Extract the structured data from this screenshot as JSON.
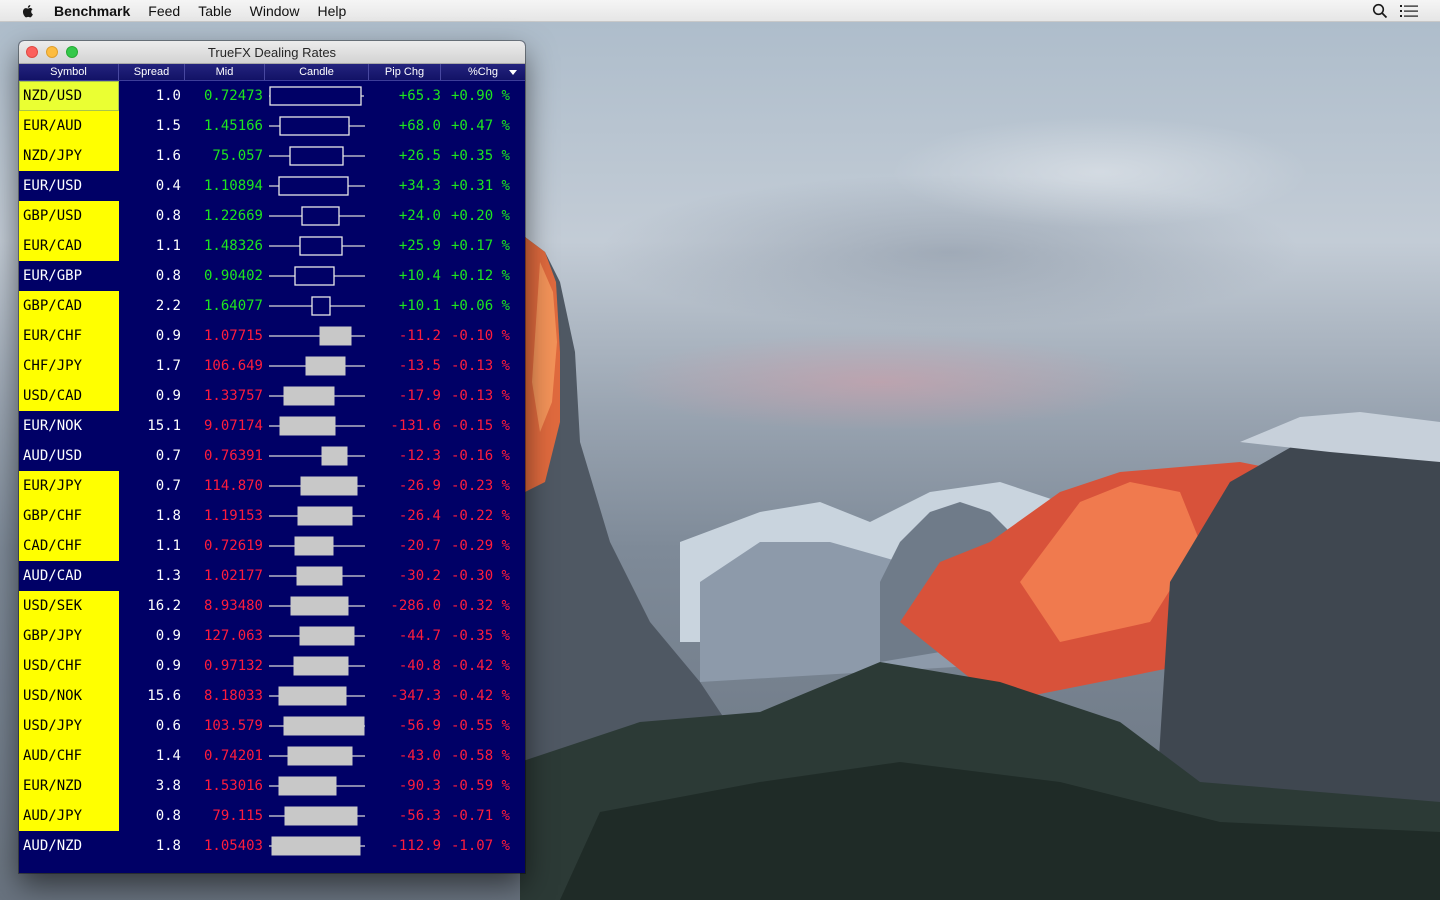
{
  "menubar": {
    "app_name": "Benchmark",
    "menus": [
      "Feed",
      "Table",
      "Window",
      "Help"
    ],
    "icons": [
      "apple-icon",
      "spotlight-search-icon",
      "notification-center-icon"
    ]
  },
  "window": {
    "title": "TrueFX Dealing Rates",
    "columns": [
      "Symbol",
      "Spread",
      "Mid",
      "Candle",
      "Pip Chg",
      "%Chg"
    ],
    "colors": {
      "background": "#000066",
      "highlight": "#ffff00",
      "up": "#1ee61e",
      "down": "#ff1c3c"
    },
    "rows": [
      {
        "symbol": "NZD/USD",
        "spread": "1.0",
        "mid": "0.72473",
        "pip_chg": "+65.3",
        "pct_chg": "+0.90 %",
        "dir": "up",
        "highlight": true,
        "selected": true,
        "candle": {
          "open": 0.03,
          "close": 0.94,
          "low": 0.02,
          "high": 0.97
        }
      },
      {
        "symbol": "EUR/AUD",
        "spread": "1.5",
        "mid": "1.45166",
        "pip_chg": "+68.0",
        "pct_chg": "+0.47 %",
        "dir": "up",
        "highlight": true,
        "candle": {
          "open": 0.13,
          "close": 0.82,
          "low": 0.02,
          "high": 0.98
        }
      },
      {
        "symbol": "NZD/JPY",
        "spread": "1.6",
        "mid": "75.057",
        "pip_chg": "+26.5",
        "pct_chg": "+0.35 %",
        "dir": "up",
        "highlight": true,
        "candle": {
          "open": 0.23,
          "close": 0.76,
          "low": 0.02,
          "high": 0.98
        }
      },
      {
        "symbol": "EUR/USD",
        "spread": "0.4",
        "mid": "1.10894",
        "pip_chg": "+34.3",
        "pct_chg": "+0.31 %",
        "dir": "up",
        "highlight": false,
        "candle": {
          "open": 0.12,
          "close": 0.81,
          "low": 0.02,
          "high": 0.98
        }
      },
      {
        "symbol": "GBP/USD",
        "spread": "0.8",
        "mid": "1.22669",
        "pip_chg": "+24.0",
        "pct_chg": "+0.20 %",
        "dir": "up",
        "highlight": true,
        "candle": {
          "open": 0.35,
          "close": 0.72,
          "low": 0.02,
          "high": 0.98
        }
      },
      {
        "symbol": "EUR/CAD",
        "spread": "1.1",
        "mid": "1.48326",
        "pip_chg": "+25.9",
        "pct_chg": "+0.17 %",
        "dir": "up",
        "highlight": true,
        "candle": {
          "open": 0.33,
          "close": 0.75,
          "low": 0.02,
          "high": 0.98
        }
      },
      {
        "symbol": "EUR/GBP",
        "spread": "0.8",
        "mid": "0.90402",
        "pip_chg": "+10.4",
        "pct_chg": "+0.12 %",
        "dir": "up",
        "highlight": false,
        "candle": {
          "open": 0.28,
          "close": 0.67,
          "low": 0.02,
          "high": 0.98
        }
      },
      {
        "symbol": "GBP/CAD",
        "spread": "2.2",
        "mid": "1.64077",
        "pip_chg": "+10.1",
        "pct_chg": "+0.06 %",
        "dir": "up",
        "highlight": true,
        "candle": {
          "open": 0.45,
          "close": 0.63,
          "low": 0.02,
          "high": 0.98
        }
      },
      {
        "symbol": "EUR/CHF",
        "spread": "0.9",
        "mid": "1.07715",
        "pip_chg": "-11.2",
        "pct_chg": "-0.10 %",
        "dir": "down",
        "highlight": true,
        "candle": {
          "open": 0.84,
          "close": 0.53,
          "low": 0.02,
          "high": 0.98
        }
      },
      {
        "symbol": "CHF/JPY",
        "spread": "1.7",
        "mid": "106.649",
        "pip_chg": "-13.5",
        "pct_chg": "-0.13 %",
        "dir": "down",
        "highlight": true,
        "candle": {
          "open": 0.78,
          "close": 0.39,
          "low": 0.02,
          "high": 0.98
        }
      },
      {
        "symbol": "USD/CAD",
        "spread": "0.9",
        "mid": "1.33757",
        "pip_chg": "-17.9",
        "pct_chg": "-0.13 %",
        "dir": "down",
        "highlight": true,
        "candle": {
          "open": 0.67,
          "close": 0.17,
          "low": 0.02,
          "high": 0.98
        }
      },
      {
        "symbol": "EUR/NOK",
        "spread": "15.1",
        "mid": "9.07174",
        "pip_chg": "-131.6",
        "pct_chg": "-0.15 %",
        "dir": "down",
        "highlight": false,
        "candle": {
          "open": 0.68,
          "close": 0.13,
          "low": 0.02,
          "high": 0.98
        }
      },
      {
        "symbol": "AUD/USD",
        "spread": "0.7",
        "mid": "0.76391",
        "pip_chg": "-12.3",
        "pct_chg": "-0.16 %",
        "dir": "down",
        "highlight": false,
        "candle": {
          "open": 0.8,
          "close": 0.55,
          "low": 0.02,
          "high": 0.98
        }
      },
      {
        "symbol": "EUR/JPY",
        "spread": "0.7",
        "mid": "114.870",
        "pip_chg": "-26.9",
        "pct_chg": "-0.23 %",
        "dir": "down",
        "highlight": true,
        "candle": {
          "open": 0.9,
          "close": 0.34,
          "low": 0.02,
          "high": 0.98
        }
      },
      {
        "symbol": "GBP/CHF",
        "spread": "1.8",
        "mid": "1.19153",
        "pip_chg": "-26.4",
        "pct_chg": "-0.22 %",
        "dir": "down",
        "highlight": true,
        "candle": {
          "open": 0.85,
          "close": 0.31,
          "low": 0.02,
          "high": 0.98
        }
      },
      {
        "symbol": "CAD/CHF",
        "spread": "1.1",
        "mid": "0.72619",
        "pip_chg": "-20.7",
        "pct_chg": "-0.29 %",
        "dir": "down",
        "highlight": true,
        "candle": {
          "open": 0.66,
          "close": 0.28,
          "low": 0.02,
          "high": 0.98
        }
      },
      {
        "symbol": "AUD/CAD",
        "spread": "1.3",
        "mid": "1.02177",
        "pip_chg": "-30.2",
        "pct_chg": "-0.30 %",
        "dir": "down",
        "highlight": false,
        "candle": {
          "open": 0.75,
          "close": 0.3,
          "low": 0.02,
          "high": 0.98
        }
      },
      {
        "symbol": "USD/SEK",
        "spread": "16.2",
        "mid": "8.93480",
        "pip_chg": "-286.0",
        "pct_chg": "-0.32 %",
        "dir": "down",
        "highlight": true,
        "candle": {
          "open": 0.81,
          "close": 0.24,
          "low": 0.02,
          "high": 0.98
        }
      },
      {
        "symbol": "GBP/JPY",
        "spread": "0.9",
        "mid": "127.063",
        "pip_chg": "-44.7",
        "pct_chg": "-0.35 %",
        "dir": "down",
        "highlight": true,
        "candle": {
          "open": 0.87,
          "close": 0.33,
          "low": 0.02,
          "high": 0.98
        }
      },
      {
        "symbol": "USD/CHF",
        "spread": "0.9",
        "mid": "0.97132",
        "pip_chg": "-40.8",
        "pct_chg": "-0.42 %",
        "dir": "down",
        "highlight": true,
        "candle": {
          "open": 0.81,
          "close": 0.27,
          "low": 0.02,
          "high": 0.98
        }
      },
      {
        "symbol": "USD/NOK",
        "spread": "15.6",
        "mid": "8.18033",
        "pip_chg": "-347.3",
        "pct_chg": "-0.42 %",
        "dir": "down",
        "highlight": true,
        "candle": {
          "open": 0.79,
          "close": 0.12,
          "low": 0.02,
          "high": 0.98
        }
      },
      {
        "symbol": "USD/JPY",
        "spread": "0.6",
        "mid": "103.579",
        "pip_chg": "-56.9",
        "pct_chg": "-0.55 %",
        "dir": "down",
        "highlight": true,
        "candle": {
          "open": 0.97,
          "close": 0.17,
          "low": 0.02,
          "high": 0.98
        }
      },
      {
        "symbol": "AUD/CHF",
        "spread": "1.4",
        "mid": "0.74201",
        "pip_chg": "-43.0",
        "pct_chg": "-0.58 %",
        "dir": "down",
        "highlight": true,
        "candle": {
          "open": 0.85,
          "close": 0.21,
          "low": 0.02,
          "high": 0.98
        }
      },
      {
        "symbol": "EUR/NZD",
        "spread": "3.8",
        "mid": "1.53016",
        "pip_chg": "-90.3",
        "pct_chg": "-0.59 %",
        "dir": "down",
        "highlight": true,
        "candle": {
          "open": 0.69,
          "close": 0.12,
          "low": 0.02,
          "high": 0.98
        }
      },
      {
        "symbol": "AUD/JPY",
        "spread": "0.8",
        "mid": "79.115",
        "pip_chg": "-56.3",
        "pct_chg": "-0.71 %",
        "dir": "down",
        "highlight": true,
        "candle": {
          "open": 0.9,
          "close": 0.18,
          "low": 0.02,
          "high": 0.98
        }
      },
      {
        "symbol": "AUD/NZD",
        "spread": "1.8",
        "mid": "1.05403",
        "pip_chg": "-112.9",
        "pct_chg": "-1.07 %",
        "dir": "down",
        "highlight": false,
        "candle": {
          "open": 0.93,
          "close": 0.05,
          "low": 0.02,
          "high": 0.98
        }
      }
    ]
  }
}
